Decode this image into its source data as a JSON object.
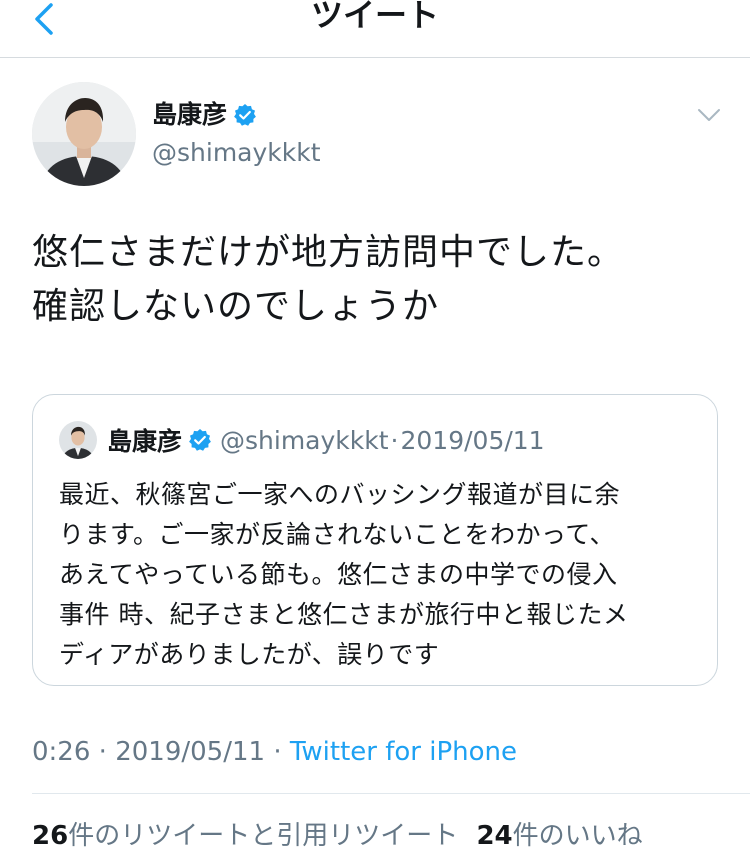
{
  "nav": {
    "title": "ツイート"
  },
  "colors": {
    "accent": "#1da1f2",
    "secondary_text": "#657786",
    "primary_text": "#14171a",
    "border": "#ccd6dd"
  },
  "icons": {
    "back": "chevron-left-icon",
    "verified": "verified-badge-icon",
    "menu": "chevron-down-icon"
  },
  "author": {
    "name": "島康彦",
    "handle": "@shimaykkkt"
  },
  "tweet": {
    "text_lines": [
      "悠仁さまだけが地方訪問中でした。",
      "確認しないのでしょうか"
    ]
  },
  "quote": {
    "name": "島康彦",
    "handle": "@shimaykkkt",
    "separator": "·",
    "date": "2019/05/11",
    "body_lines": [
      "最近、秋篠宮ご一家へのバッシング報道が目に余",
      "ります。ご一家が反論されないことをわかって、",
      "あえてやっている節も。悠仁さまの中学での侵入",
      "事件 時、紀子さまと悠仁さまが旅行中と報じたメ",
      "ディアがありましたが、誤りです"
    ]
  },
  "meta": {
    "time": "0:26",
    "separator": "·",
    "date": "2019/05/11",
    "source": "Twitter for iPhone"
  },
  "stats": {
    "retweet_count": "26",
    "retweet_label": "件のリツイートと引用リツイート",
    "like_count": "24",
    "like_label": "件のいいね"
  }
}
